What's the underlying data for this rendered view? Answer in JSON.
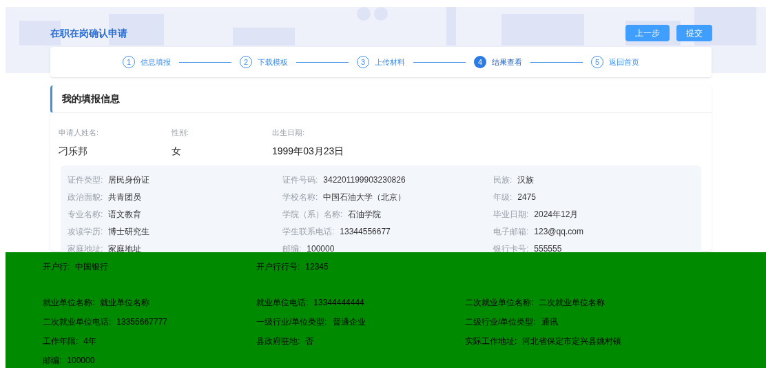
{
  "header": {
    "title": "在职在岗确认申请",
    "buttons": [
      "上一步",
      "提交"
    ]
  },
  "steps": [
    {
      "number": "1",
      "label": "信息填报",
      "selected": false
    },
    {
      "number": "2",
      "label": "下载模板",
      "selected": false
    },
    {
      "number": "3",
      "label": "上传材料",
      "selected": false
    },
    {
      "number": "4",
      "label": "结果查看",
      "selected": true
    },
    {
      "number": "5",
      "label": "返回首页",
      "selected": false
    }
  ],
  "section_title": "我的填报信息",
  "basic_fields": [
    {
      "label": "申请人姓名:",
      "value": "刁乐邦"
    },
    {
      "label": "性别:",
      "value": "女"
    },
    {
      "label": "出生日期:",
      "value": "1999年03月23日"
    }
  ],
  "details": [
    {
      "label": "证件类型:",
      "value": "居民身份证"
    },
    {
      "label": "证件号码:",
      "value": "342201199903230826"
    },
    {
      "label": "民族:",
      "value": "汉族"
    },
    {
      "label": "政治面貌:",
      "value": "共青团员"
    },
    {
      "label": "学校名称:",
      "value": "中国石油大学（北京）"
    },
    {
      "label": "年级:",
      "value": "2475"
    },
    {
      "label": "专业名称:",
      "value": "语文教育"
    },
    {
      "label": "学院（系）名称:",
      "value": "石油学院"
    },
    {
      "label": "毕业日期:",
      "value": "2024年12月"
    },
    {
      "label": "攻读学历:",
      "value": "博士研究生"
    },
    {
      "label": "学生联系电话:",
      "value": "13344556677"
    },
    {
      "label": "电子邮箱:",
      "value": "123@qq.com"
    },
    {
      "label": "家庭地址:",
      "value": "家庭地址"
    },
    {
      "label": "邮编:",
      "value": "100000"
    },
    {
      "label": "银行卡号:",
      "value": "555555"
    }
  ],
  "covered_bank": [
    {
      "label": "开户行:",
      "value": "中国银行"
    },
    {
      "label": "开户行行号:",
      "value": "12345"
    }
  ],
  "covered_employment": [
    {
      "label": "就业单位名称:",
      "value": "就业单位名称"
    },
    {
      "label": "就业单位电话:",
      "value": "13344444444"
    },
    {
      "label": "二次就业单位名称:",
      "value": "二次就业单位名称"
    },
    {
      "label": "二次就业单位电话:",
      "value": "13355667777"
    },
    {
      "label": "一级行业/单位类型:",
      "value": "普通企业"
    },
    {
      "label": "二级行业/单位类型:",
      "value": "通讯"
    },
    {
      "label": "工作年限:",
      "value": "4年"
    },
    {
      "label": "县政府驻地:",
      "value": "否"
    },
    {
      "label": "实际工作地址:",
      "value": "河北省保定市定兴县姚村镇"
    },
    {
      "label": "邮编:",
      "value": "100000"
    }
  ]
}
